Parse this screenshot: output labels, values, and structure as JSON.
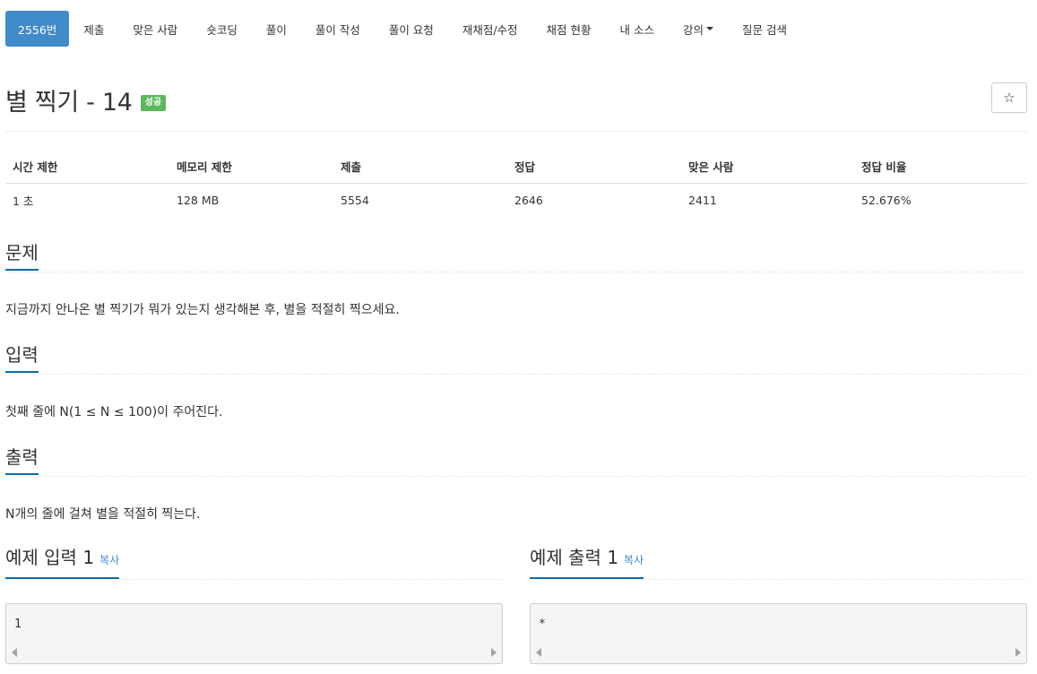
{
  "tabs": [
    {
      "label": "2556번",
      "active": true
    },
    {
      "label": "제출"
    },
    {
      "label": "맞은 사람"
    },
    {
      "label": "숏코딩"
    },
    {
      "label": "풀이"
    },
    {
      "label": "풀이 작성"
    },
    {
      "label": "풀이 요청"
    },
    {
      "label": "재채점/수정"
    },
    {
      "label": "채점 현황"
    },
    {
      "label": "내 소스"
    },
    {
      "label": "강의",
      "dropdown": true
    },
    {
      "label": "질문 검색"
    }
  ],
  "problem": {
    "title": "별 찍기 - 14",
    "badge": "성공",
    "star_icon": "☆"
  },
  "info": {
    "headers": [
      "시간 제한",
      "메모리 제한",
      "제출",
      "정답",
      "맞은 사람",
      "정답 비율"
    ],
    "values": [
      "1 초",
      "128 MB",
      "5554",
      "2646",
      "2411",
      "52.676%"
    ]
  },
  "sections": {
    "description": {
      "title": "문제",
      "text": "지금까지 안나온 별 찍기가 뭐가 있는지 생각해본 후, 별을 적절히 찍으세요."
    },
    "input": {
      "title": "입력",
      "text": "첫째 줄에 N(1 ≤ N ≤ 100)이 주어진다."
    },
    "output": {
      "title": "출력",
      "text": "N개의 줄에 걸쳐 별을 적절히 찍는다."
    }
  },
  "samples": {
    "input": {
      "title": "예제 입력 1",
      "copy": "복사",
      "content": "1"
    },
    "output": {
      "title": "예제 출력 1",
      "copy": "복사",
      "content": "*"
    }
  },
  "colors": {
    "accent": "#428bca",
    "success": "#5cb85c",
    "underline": "#0d6aa6"
  }
}
